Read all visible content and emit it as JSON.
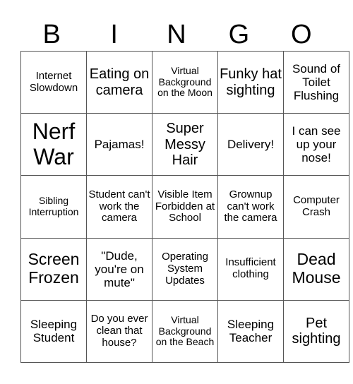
{
  "title_letters": [
    "B",
    "I",
    "N",
    "G",
    "O"
  ],
  "cells": [
    [
      "Internet Slowdown",
      "Eating on camera",
      "Virtual Background on the Moon",
      "Funky hat sighting",
      "Sound of Toilet Flushing"
    ],
    [
      "Nerf War",
      "Pajamas!",
      "Super Messy Hair",
      "Delivery!",
      "I can see up your nose!"
    ],
    [
      "Sibling Interruption",
      "Student can't work the camera",
      "Visible Item Forbidden at School",
      "Grownup can't work the camera",
      "Computer Crash"
    ],
    [
      "Screen Frozen",
      "\"Dude, you're on mute\"",
      "Operating System Updates",
      "Insufficient clothing",
      "Dead Mouse"
    ],
    [
      "Sleeping Student",
      "Do you ever clean that house?",
      "Virtual Background on the Beach",
      "Sleeping Teacher",
      "Pet sighting"
    ]
  ]
}
